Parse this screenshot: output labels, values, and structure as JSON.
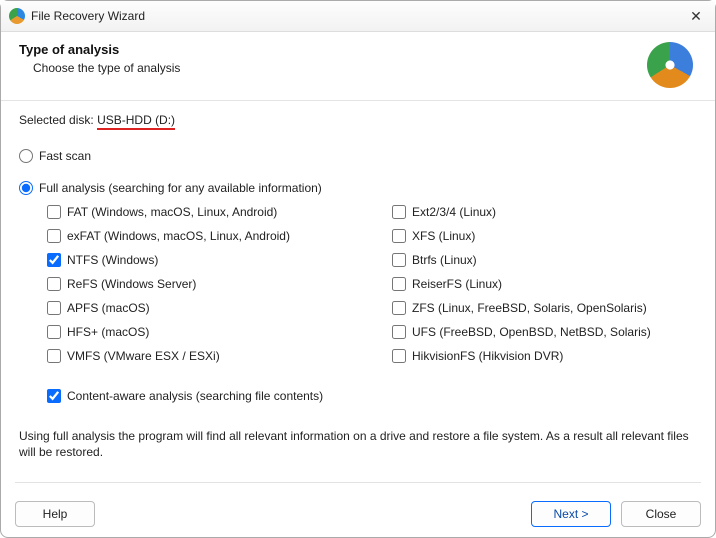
{
  "window": {
    "title": "File Recovery Wizard"
  },
  "header": {
    "title": "Type of analysis",
    "subtitle": "Choose the type of analysis"
  },
  "selected": {
    "label": "Selected disk:",
    "value": "USB-HDD (D:)"
  },
  "scan": {
    "fast": {
      "label": "Fast scan",
      "checked": false
    },
    "full": {
      "label": "Full analysis (searching for any available information)",
      "checked": true
    }
  },
  "filesystems": {
    "left": [
      {
        "id": "fat",
        "label": "FAT (Windows, macOS, Linux, Android)",
        "checked": false
      },
      {
        "id": "exfat",
        "label": "exFAT (Windows, macOS, Linux, Android)",
        "checked": false
      },
      {
        "id": "ntfs",
        "label": "NTFS (Windows)",
        "checked": true
      },
      {
        "id": "refs",
        "label": "ReFS (Windows Server)",
        "checked": false
      },
      {
        "id": "apfs",
        "label": "APFS (macOS)",
        "checked": false
      },
      {
        "id": "hfs",
        "label": "HFS+ (macOS)",
        "checked": false
      },
      {
        "id": "vmfs",
        "label": "VMFS (VMware ESX / ESXi)",
        "checked": false
      }
    ],
    "right": [
      {
        "id": "ext",
        "label": "Ext2/3/4 (Linux)",
        "checked": false
      },
      {
        "id": "xfs",
        "label": "XFS (Linux)",
        "checked": false
      },
      {
        "id": "btrfs",
        "label": "Btrfs (Linux)",
        "checked": false
      },
      {
        "id": "reiser",
        "label": "ReiserFS (Linux)",
        "checked": false
      },
      {
        "id": "zfs",
        "label": "ZFS (Linux, FreeBSD, Solaris, OpenSolaris)",
        "checked": false
      },
      {
        "id": "ufs",
        "label": "UFS (FreeBSD, OpenBSD, NetBSD, Solaris)",
        "checked": false
      },
      {
        "id": "hik",
        "label": "HikvisionFS (Hikvision DVR)",
        "checked": false
      }
    ]
  },
  "contentAware": {
    "label": "Content-aware analysis (searching file contents)",
    "checked": true
  },
  "description": "Using full analysis the program will find all relevant information on a drive and restore a file system. As a result all relevant files will be restored.",
  "footer": {
    "help": "Help",
    "next": "Next >",
    "close": "Close"
  }
}
